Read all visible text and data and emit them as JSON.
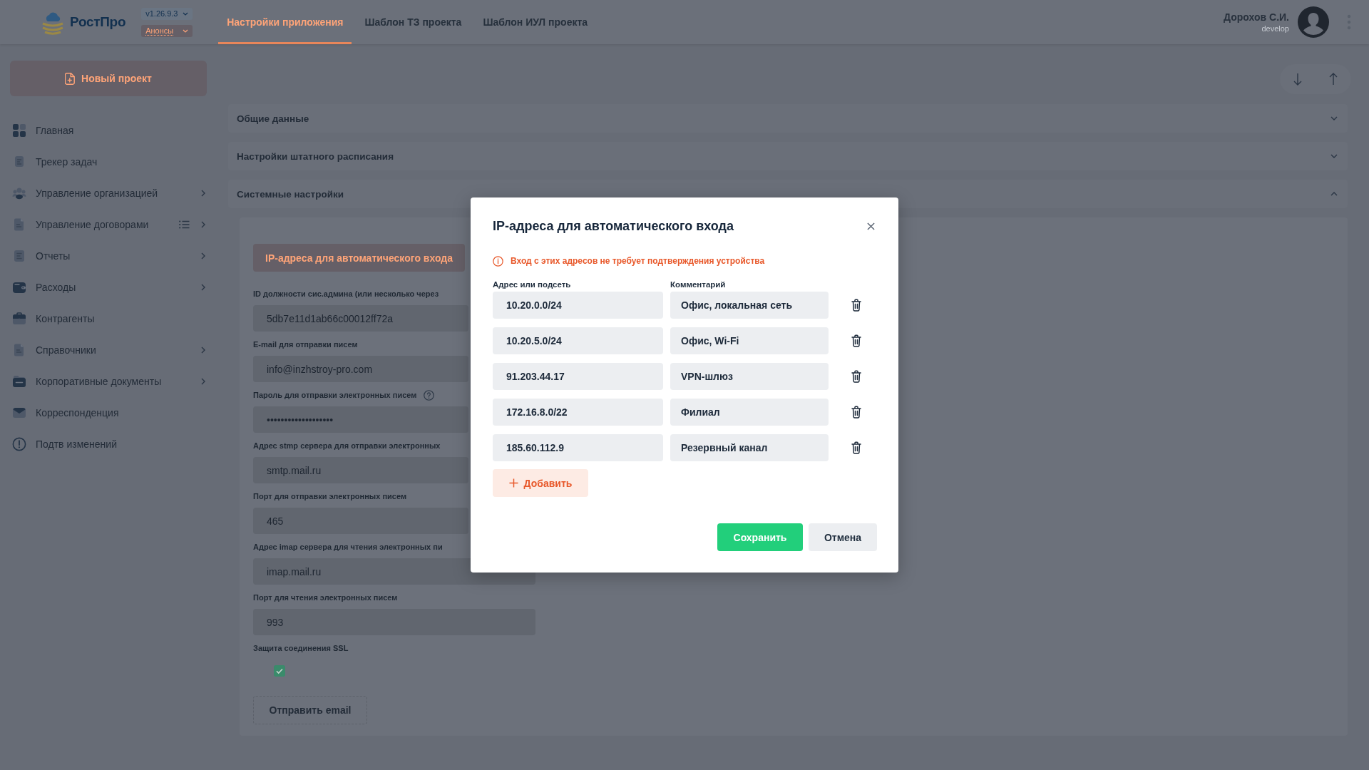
{
  "header": {
    "logo": "РостПро",
    "version": "v1.26.9.3",
    "announcements": "Анонсы",
    "tabs": [
      {
        "label": "Настройки приложения",
        "selected": true
      },
      {
        "label": "Шаблон ТЗ проекта",
        "selected": false
      },
      {
        "label": "Шаблон ИУЛ проекта",
        "selected": false
      }
    ],
    "user": {
      "name": "Дорохов С.И.",
      "role": "develop"
    }
  },
  "sidebar": {
    "new_project_button": "Новый проект",
    "items": [
      {
        "label": "Главная",
        "has_submenu": false,
        "selected": false
      },
      {
        "label": "Трекер задач",
        "has_submenu": false,
        "selected": false
      },
      {
        "label": "Управление организацией",
        "has_submenu": true,
        "selected": false
      },
      {
        "label": "Управление договорами",
        "has_submenu": true,
        "selected": false
      },
      {
        "label": "Отчеты",
        "has_submenu": true,
        "selected": false
      },
      {
        "label": "Расходы",
        "has_submenu": true,
        "selected": false
      },
      {
        "label": "Контрагенты",
        "has_submenu": false,
        "selected": false
      },
      {
        "label": "Справочники",
        "has_submenu": true,
        "selected": false
      },
      {
        "label": "Корпоративные документы",
        "has_submenu": true,
        "selected": false
      },
      {
        "label": "Корреспонденция",
        "has_submenu": false,
        "selected": false
      },
      {
        "label": "Подтв изменений",
        "has_submenu": false,
        "selected": false
      }
    ]
  },
  "sections": [
    {
      "title": "Общие данные",
      "expanded": false
    },
    {
      "title": "Настройки штатного расписания",
      "expanded": false
    },
    {
      "title": "Системные настройки",
      "expanded": true
    }
  ],
  "system_settings": {
    "ip_button": "IP-адреса для автоматического входа",
    "fields": [
      {
        "label": "ID должности сис.админа (или несколько через",
        "value": "5db7e11d1ab66c00012ff72a",
        "help": false
      },
      {
        "label": "E-mail для отправки писем",
        "value": "info@inzhstroy-pro.com",
        "help": false
      },
      {
        "label": "Пароль для отправки электронных писем",
        "value": "•••••••••••••••••••",
        "help": true
      },
      {
        "label": "Адрес stmp сервера для отправки электронных",
        "value": "smtp.mail.ru",
        "help": false
      },
      {
        "label": "Порт для отправки электронных писем",
        "value": "465",
        "help": false
      },
      {
        "label": "Адрес imap сервера для чтения электронных пи",
        "value": "imap.mail.ru",
        "help": false
      },
      {
        "label": "Порт для чтения электронных писем",
        "value": "993",
        "help": false
      }
    ],
    "ssl": {
      "label": "Защита соединения SSL",
      "checked": true
    },
    "send_button": "Отправить email"
  },
  "dialog": {
    "title": "IP-адреса для автоматического входа",
    "notice": "Вход с этих адресов не требует подтверждения устройства",
    "columns": [
      "Адрес или подсеть",
      "Комментарий"
    ],
    "rows": [
      {
        "address": "10.20.0.0/24",
        "comment": "Офис, локальная сеть"
      },
      {
        "address": "10.20.5.0/24",
        "comment": "Офис, Wi-Fi"
      },
      {
        "address": "91.203.44.17",
        "comment": "VPN-шлюз"
      },
      {
        "address": "172.16.8.0/22",
        "comment": "Филиал"
      },
      {
        "address": "185.60.112.9",
        "comment": "Резервный канал"
      }
    ],
    "add_button": "Добавить",
    "save_button": "Сохранить",
    "cancel_button": "Отмена"
  }
}
